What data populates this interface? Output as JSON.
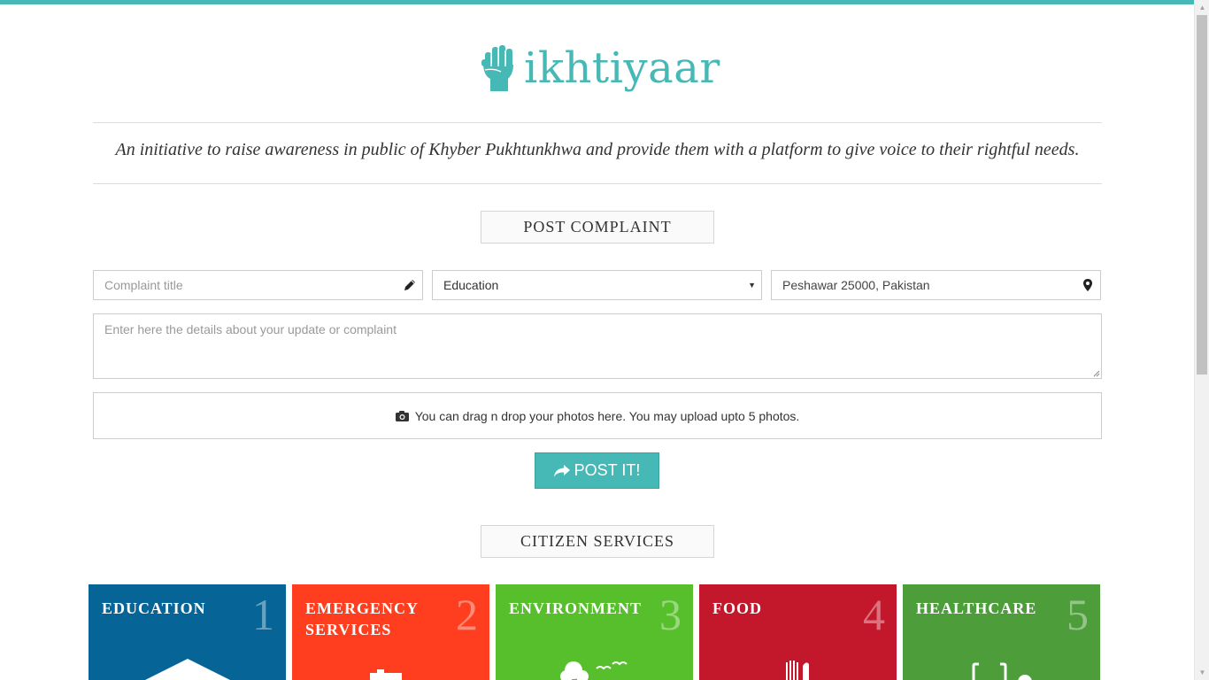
{
  "brand": {
    "name": "ikhtiyaar",
    "tagline": "An initiative to raise awareness in public of Khyber Pukhtunkhwa and provide them with a platform to give voice to their rightful needs.",
    "accent_color": "#46b8b5"
  },
  "complaint_form": {
    "section_title": "POST COMPLAINT",
    "title_field": {
      "placeholder": "Complaint title",
      "icon": "pencil-icon"
    },
    "category_select": {
      "selected": "Education"
    },
    "location_field": {
      "value": "Peshawar 25000, Pakistan",
      "icon": "map-marker-icon"
    },
    "details_field": {
      "placeholder": "Enter here the details about your update or complaint"
    },
    "photo_dropzone": {
      "icon": "camera-icon",
      "text": "You can drag n drop your photos here. You may upload upto 5 photos."
    },
    "submit": {
      "label": "POST IT!",
      "icon": "share-arrow-icon"
    }
  },
  "services": {
    "section_title": "CITIZEN SERVICES",
    "tiles": [
      {
        "name": "EDUCATION",
        "number": "1",
        "color": "#066497",
        "icon": "school-icon"
      },
      {
        "name": "EMERGENCY SERVICES",
        "number": "2",
        "color": "#fe3e1e",
        "icon": "ambulance-icon"
      },
      {
        "name": "ENVIRONMENT",
        "number": "3",
        "color": "#57bf2b",
        "icon": "tree-birds-icon"
      },
      {
        "name": "FOOD",
        "number": "4",
        "color": "#c3172b",
        "icon": "fork-knife-icon"
      },
      {
        "name": "HEALTHCARE",
        "number": "5",
        "color": "#4d9d3b",
        "icon": "stethoscope-icon"
      }
    ]
  }
}
